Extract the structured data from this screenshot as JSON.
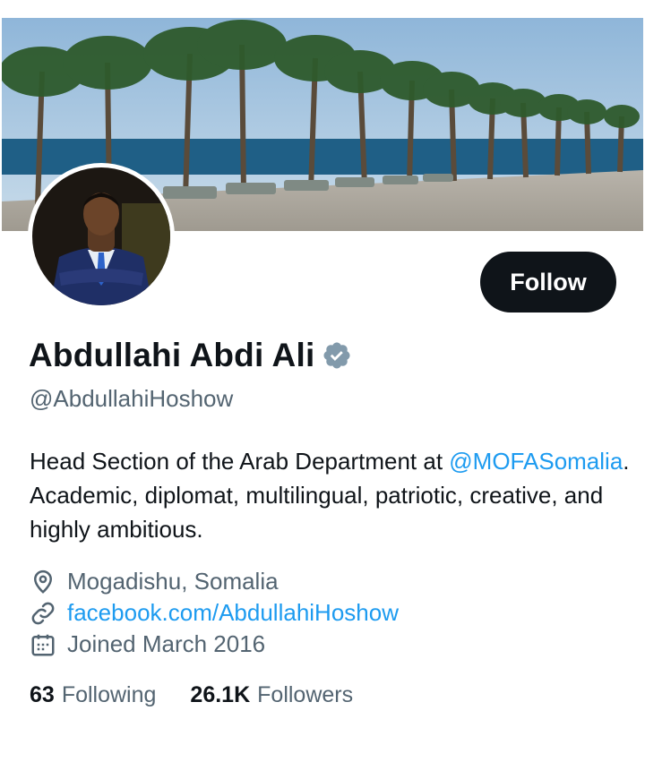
{
  "profile": {
    "display_name": "Abdullahi Abdi Ali",
    "handle": "@AbdullahiHoshow",
    "verified": true,
    "bio_text_1": "Head Section of the Arab Department at ",
    "bio_mention": "@MOFASomalia",
    "bio_text_2": ". Academic, diplomat, multilingual, patriotic, creative, and highly ambitious.",
    "location": "Mogadishu, Somalia",
    "website": "facebook.com/AbdullahiHoshow",
    "joined": "Joined March 2016"
  },
  "actions": {
    "follow_label": "Follow"
  },
  "stats": {
    "following_count": "63",
    "following_label": "Following",
    "followers_count": "26.1K",
    "followers_label": "Followers"
  },
  "colors": {
    "accent": "#1d9bf0",
    "text": "#0f1419",
    "muted": "#536471",
    "button": "#0f1419"
  },
  "icons": [
    "verified-badge-icon",
    "location-pin-icon",
    "link-icon",
    "calendar-icon"
  ]
}
